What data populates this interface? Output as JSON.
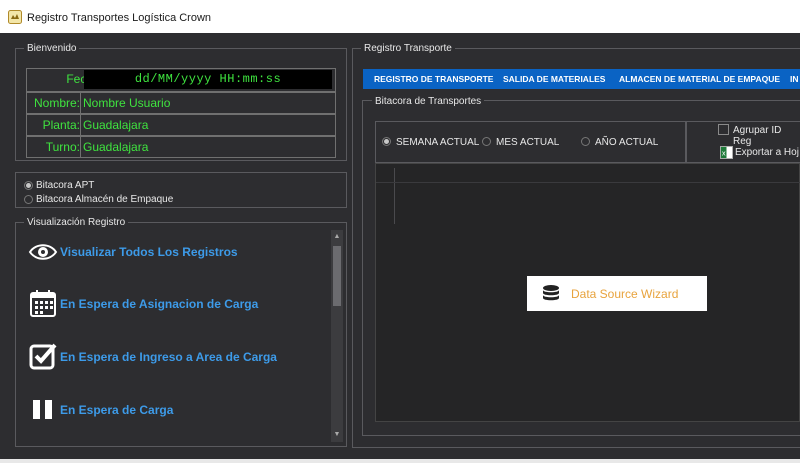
{
  "window": {
    "title": "Registro Transportes Logística Crown"
  },
  "welcome": {
    "title": "Bienvenido",
    "fields": [
      {
        "label": "Fecha:",
        "value": "dd/MM/yyyy  HH:mm:ss"
      },
      {
        "label": "Nombre:",
        "value": "Nombre Usuario"
      },
      {
        "label": "Planta:",
        "value": "Guadalajara"
      },
      {
        "label": "Turno:",
        "value": "Guadalajara"
      }
    ]
  },
  "log_options": [
    {
      "label": "Bitacora APT",
      "selected": true
    },
    {
      "label": "Bitacora Almacén de Empaque",
      "selected": false
    }
  ],
  "view": {
    "title": "Visualización Registro",
    "items": [
      {
        "label": "Visualizar Todos Los Registros",
        "icon": "eye-icon"
      },
      {
        "label": "En Espera de Asignacion de Carga",
        "icon": "calendar-icon"
      },
      {
        "label": "En Espera de Ingreso a Area de Carga",
        "icon": "checkbox-icon"
      },
      {
        "label": "En Espera de Carga",
        "icon": "pause-icon"
      }
    ]
  },
  "transport": {
    "title": "Registro Transporte",
    "tabs": [
      {
        "label": "REGISTRO DE TRANSPORTE"
      },
      {
        "label": "SALIDA DE MATERIALES"
      },
      {
        "label": "ALMACEN DE MATERIAL DE EMPAQUE"
      },
      {
        "label": "IN"
      }
    ],
    "log_title": "Bitacora de Transportes",
    "periods": [
      {
        "label": "SEMANA ACTUAL",
        "selected": true
      },
      {
        "label": "MES ACTUAL",
        "selected": false
      },
      {
        "label": "AÑO ACTUAL",
        "selected": false
      }
    ],
    "group_label": "Agrupar ID Reg",
    "export_label": "Exportar a Hoj",
    "wizard_label": "Data Source Wizard"
  },
  "colors": {
    "accent": "#3d9be9",
    "lcd_text": "#3fe43f",
    "tab_strip": "#0a63c4",
    "wizard_text": "#e8a33d"
  }
}
